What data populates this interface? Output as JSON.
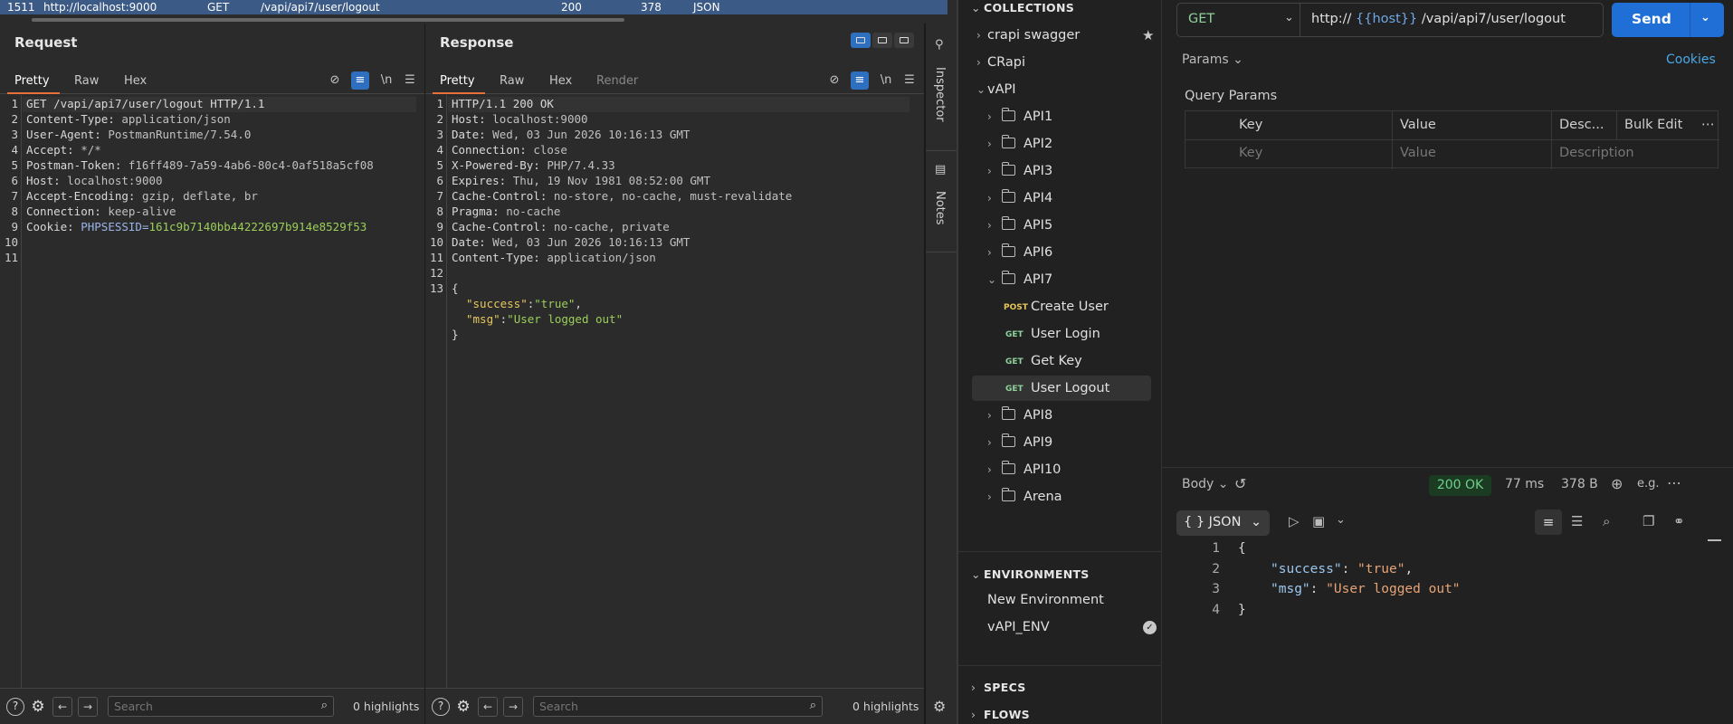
{
  "history_row": {
    "num": "1511",
    "host": "http://localhost:9000",
    "method": "GET",
    "url": "/vapi/api7/user/logout",
    "status": "200",
    "length": "378",
    "mime": "JSON"
  },
  "request": {
    "title": "Request",
    "tabs": [
      "Pretty",
      "Raw",
      "Hex"
    ],
    "icons": {
      "eye": "⊘",
      "wrap": "≡",
      "nl": "\\n",
      "menu": "☰"
    },
    "lines": [
      {
        "n": "1",
        "k": "GET /vapi/api7/user/logout HTTP/1.1",
        "v": ""
      },
      {
        "n": "2",
        "k": "Content-Type:",
        "v": " application/json"
      },
      {
        "n": "3",
        "k": "User-Agent:",
        "v": " PostmanRuntime/7.54.0"
      },
      {
        "n": "4",
        "k": "Accept:",
        "v": " */*"
      },
      {
        "n": "5",
        "k": "Postman-Token:",
        "v": " f16ff489-7a59-4ab6-80c4-0af518a5cf08"
      },
      {
        "n": "6",
        "k": "Host:",
        "v": " localhost:9000"
      },
      {
        "n": "7",
        "k": "Accept-Encoding:",
        "v": " gzip, deflate, br"
      },
      {
        "n": "8",
        "k": "Connection:",
        "v": " keep-alive"
      },
      {
        "n": "9",
        "k": "Cookie:",
        "v": " PHPSESSID="
      },
      {
        "n": "10",
        "k": "",
        "v": ""
      },
      {
        "n": "11",
        "k": "",
        "v": ""
      }
    ],
    "session_id": "161c9b7140bb44222697b914e8529f53",
    "search_placeholder": "Search",
    "highlights": "0 highlights"
  },
  "response": {
    "title": "Response",
    "tabs": [
      "Pretty",
      "Raw",
      "Hex",
      "Render"
    ],
    "lines": [
      {
        "n": "1",
        "k": "HTTP/1.1 200 OK",
        "v": ""
      },
      {
        "n": "2",
        "k": "Host:",
        "v": " localhost:9000"
      },
      {
        "n": "3",
        "k": "Date:",
        "v": " Wed, 03 Jun 2026 10:16:13 GMT"
      },
      {
        "n": "4",
        "k": "Connection:",
        "v": " close"
      },
      {
        "n": "5",
        "k": "X-Powered-By:",
        "v": " PHP/7.4.33"
      },
      {
        "n": "6",
        "k": "Expires:",
        "v": " Thu, 19 Nov 1981 08:52:00 GMT"
      },
      {
        "n": "7",
        "k": "Cache-Control:",
        "v": " no-store, no-cache, must-revalidate"
      },
      {
        "n": "8",
        "k": "Pragma:",
        "v": " no-cache"
      },
      {
        "n": "9",
        "k": "Cache-Control:",
        "v": " no-cache, private"
      },
      {
        "n": "10",
        "k": "Date:",
        "v": " Wed, 03 Jun 2026 10:16:13 GMT"
      },
      {
        "n": "11",
        "k": "Content-Type:",
        "v": " application/json"
      },
      {
        "n": "12",
        "k": "",
        "v": ""
      },
      {
        "n": "13",
        "k": "{",
        "v": ""
      }
    ],
    "json": {
      "brace_open": "{",
      "k1": "\"success\"",
      "v1": "\"true\"",
      "k2": "\"msg\"",
      "v2": "\"User logged out\"",
      "brace_close": "}"
    },
    "search_placeholder": "Search",
    "highlights": "0 highlights"
  },
  "side": {
    "inspector": "Inspector",
    "notes": "Notes"
  },
  "collections": {
    "header": "COLLECTIONS",
    "top": [
      {
        "label": "crapi swagger"
      },
      {
        "label": "CRapi"
      },
      {
        "label": "vAPI"
      }
    ],
    "folders_before": [
      "API1",
      "API2",
      "API3",
      "API4",
      "API5",
      "API6",
      "API7"
    ],
    "api7_items": [
      {
        "method": "POST",
        "label": "Create User"
      },
      {
        "method": "GET",
        "label": "User Login"
      },
      {
        "method": "GET",
        "label": "Get Key"
      },
      {
        "method": "GET",
        "label": "User Logout"
      }
    ],
    "folders_after": [
      "API8",
      "API9",
      "API10",
      "Arena"
    ]
  },
  "environments": {
    "header": "ENVIRONMENTS",
    "items": [
      "New Environment",
      "vAPI_ENV"
    ]
  },
  "specs": "SPECS",
  "flows": "FLOWS",
  "urlbar": {
    "method": "GET",
    "prefix": "http://",
    "var": "{{host}}",
    "path": "/vapi/api7/user/logout",
    "send": "Send"
  },
  "params_tab": "Params",
  "cookies": "Cookies",
  "query_params": {
    "title": "Query Params",
    "headers": [
      "Key",
      "Value",
      "Desc...",
      "Bulk Edit"
    ],
    "key_placeholder": "Key",
    "value_placeholder": "Value",
    "desc_placeholder": "Description"
  },
  "resp_toolbar": {
    "body": "Body",
    "status": "200 OK",
    "time": "77 ms",
    "size": "378 B",
    "format": "{ } JSON"
  },
  "resp_json": {
    "l1": "{",
    "k1": "\"success\"",
    "v1": "\"true\"",
    "k2": "\"msg\"",
    "v2": "\"User logged out\"",
    "l4": "}"
  },
  "colors": {
    "accent": "#e8703a",
    "send": "#1f6fd6",
    "ok": "#6ed08a"
  }
}
